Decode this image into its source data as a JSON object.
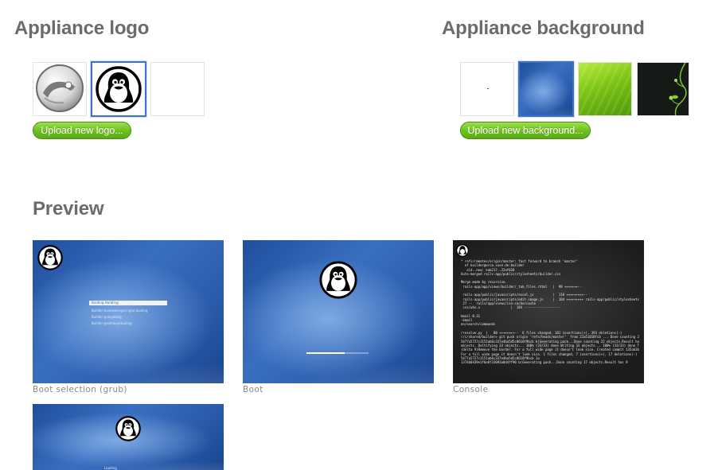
{
  "logo_section": {
    "title": "Appliance logo",
    "upload_label": "Upload new logo...",
    "items": [
      {
        "name": "opensuse-logo",
        "selected": false
      },
      {
        "name": "tux-logo",
        "selected": true
      },
      {
        "name": "empty-logo",
        "selected": false
      }
    ]
  },
  "background_section": {
    "title": "Appliance background",
    "upload_label": "Upload new background...",
    "items": [
      {
        "name": "blank-background",
        "selected": false
      },
      {
        "name": "blue-background",
        "selected": true
      },
      {
        "name": "green-background",
        "selected": false
      },
      {
        "name": "dark-vine-background",
        "selected": false
      }
    ]
  },
  "preview_section": {
    "title": "Preview",
    "items": [
      {
        "caption": "Boot selection (grub)",
        "menu": [
          "Booting Harbling",
          "Builder buhowelerge/c-grul bunling",
          "Builder grulspbling",
          "Builder greshaupetuuling"
        ]
      },
      {
        "caption": "Boot",
        "progress": 0.62
      },
      {
        "caption": "Console",
        "lines": [
          "* refs/remotes/origin/master: fast forward to branch 'master'",
          "  of builder@orca.suse.de:builder",
          "   old..new: eab217..22af018",
          "Auto-merged rails-app/public/stylesheets/builder.css",
          "",
          "Merge made by recursive.",
          " rails-app/app/views/builder/_tab_files.rhtml   |  98 +++++++--",
          "",
          " rails-app/public/javascripts/excel.js          |  110 +++++++++--",
          " rails-app/public/javascripts/edit-image.js     |  104 +++++++++ rails-app/public/stylesheets/builder.css",
          " 27 --  rails/app/views/iso-cache/cache",
          " css/whx.x                |  184 -------------------",
          "",
          "kmail-0.31",
          "-kmail",
          "en/search/commands",
          "",
          "/resolve.py  |   88 ++++++++--  6 files changed, 181 insertions(+), 393 deletions(-)",
          "r/c/shared/builder> git push origin 'refs/heads/master'  from 22a51018fcb ... Done counting 22 objects",
          "5477a5727c3151ab6c337e4ba5d5c0618f9bcb b(Generating pack...Done counting 22 objects.Result has 33",
          "objects. Deltifying 33 objects... 100% (33/33) done Writing 33 objects... 100% (33/33) done Total 33",
          "(delta 9)Remove the border. For a full wide page it doesn't look nice. Created commit 135ab3b",
          "For a full wide page it doesn't look nice. 1 files changed, 7 insertions(+), 17 deletions(-)",
          "5477a5727c3151ab6c337e4ba5d5c0618f9bcb 1a",
          "1374b0439e1f6e8f33093a0d4ff90 b(Generating pack...Done counting 17 objects.Result has 9"
        ]
      },
      {
        "caption": "",
        "label": "Loading"
      }
    ]
  }
}
